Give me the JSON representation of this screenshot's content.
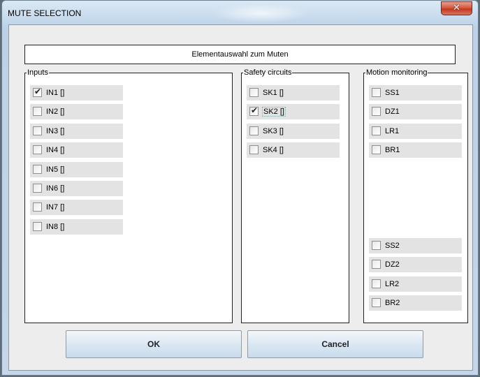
{
  "window": {
    "title": "MUTE SELECTION",
    "close_icon": "✕"
  },
  "header": {
    "text": "Elementauswahl zum Muten"
  },
  "groups": {
    "inputs": {
      "legend": "Inputs",
      "items": [
        {
          "label": "IN1 []",
          "checked": true
        },
        {
          "label": "IN2 []",
          "checked": false
        },
        {
          "label": "IN3 []",
          "checked": false
        },
        {
          "label": "IN4 []",
          "checked": false
        },
        {
          "label": "IN5 []",
          "checked": false
        },
        {
          "label": "IN6 []",
          "checked": false
        },
        {
          "label": "IN7 []",
          "checked": false
        },
        {
          "label": "IN8 []",
          "checked": false
        }
      ]
    },
    "safety": {
      "legend": "Safety circuits",
      "items": [
        {
          "label": "SK1 []",
          "checked": false
        },
        {
          "label": "SK2 []",
          "checked": true
        },
        {
          "label": "SK3 []",
          "checked": false
        },
        {
          "label": "SK4 []",
          "checked": false
        }
      ]
    },
    "motion": {
      "legend": "Motion monitoring",
      "items": [
        {
          "label": "SS1",
          "checked": false
        },
        {
          "label": "DZ1",
          "checked": false
        },
        {
          "label": "LR1",
          "checked": false
        },
        {
          "label": "BR1",
          "checked": false
        },
        {
          "label": "SS2",
          "checked": false
        },
        {
          "label": "DZ2",
          "checked": false
        },
        {
          "label": "LR2",
          "checked": false
        },
        {
          "label": "BR2",
          "checked": false
        }
      ]
    }
  },
  "buttons": {
    "ok": "OK",
    "cancel": "Cancel"
  },
  "checkmark": "✔"
}
